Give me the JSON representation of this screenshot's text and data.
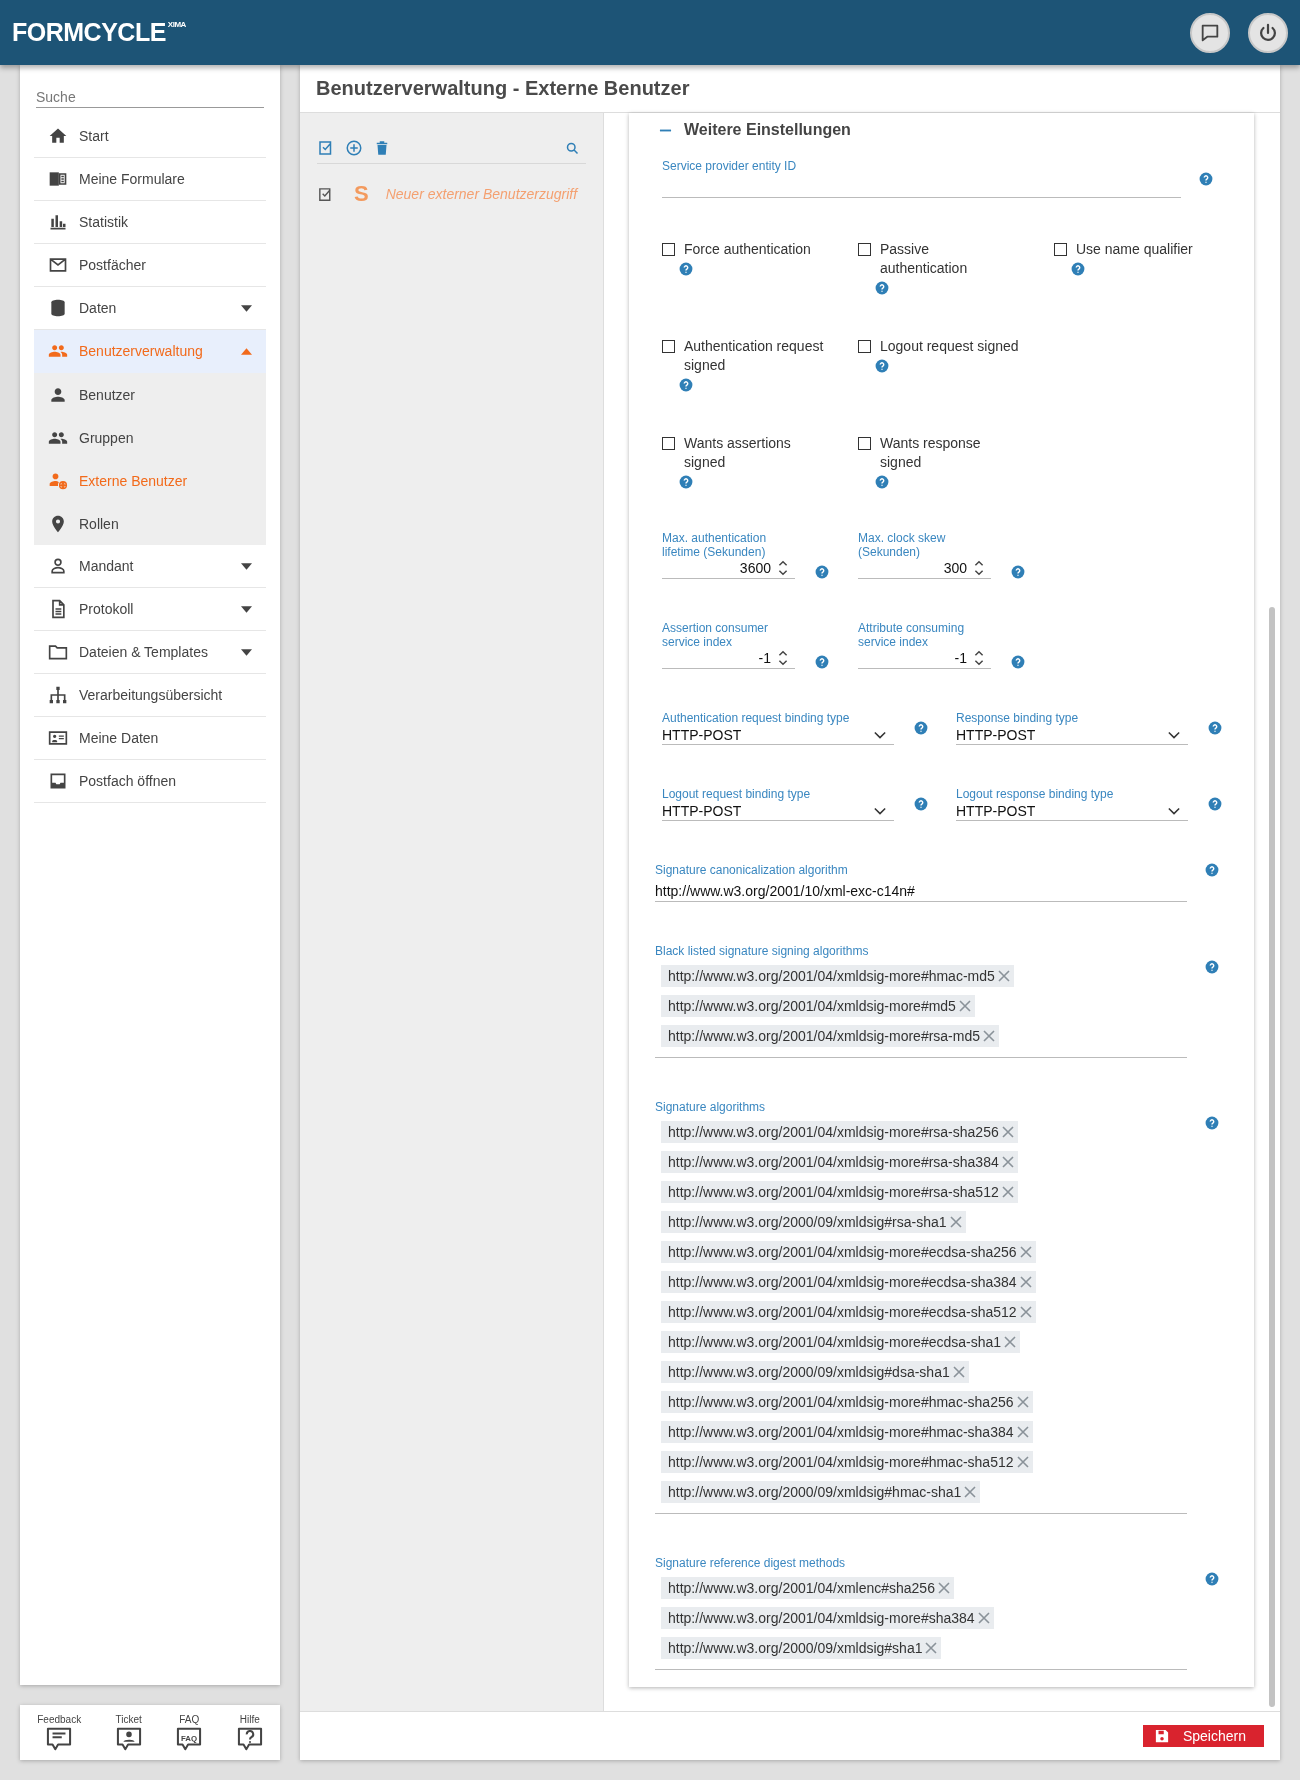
{
  "header": {
    "logo": "FORMCYCLE",
    "logo_sup": "XIMA"
  },
  "sidebar": {
    "search": {
      "placeholder": "Suche"
    },
    "items": [
      {
        "label": "Start",
        "selected": false
      },
      {
        "label": "Meine Formulare",
        "selected": false
      },
      {
        "label": "Statistik",
        "selected": false
      },
      {
        "label": "Postfächer",
        "selected": false
      },
      {
        "label": "Daten",
        "selected": false,
        "expanded": false
      },
      {
        "label": "Benutzerverwaltung",
        "selected": true,
        "expanded": true,
        "children": [
          {
            "label": "Benutzer",
            "selected": false
          },
          {
            "label": "Gruppen",
            "selected": false
          },
          {
            "label": "Externe Benutzer",
            "selected": true
          },
          {
            "label": "Rollen",
            "selected": false
          }
        ]
      },
      {
        "label": "Mandant",
        "selected": false,
        "expanded": false
      },
      {
        "label": "Protokoll",
        "selected": false,
        "expanded": false
      },
      {
        "label": "Dateien & Templates",
        "selected": false,
        "expanded": false
      },
      {
        "label": "Verarbeitungsübersicht",
        "selected": false
      },
      {
        "label": "Meine Daten",
        "selected": false
      },
      {
        "label": "Postfach öffnen",
        "selected": false
      }
    ]
  },
  "footer_links": [
    {
      "label": "Feedback"
    },
    {
      "label": "Ticket"
    },
    {
      "label": "FAQ",
      "icon_text": "FAQ"
    },
    {
      "label": "Hilfe"
    }
  ],
  "page_title": "Benutzerverwaltung - Externe Benutzer",
  "list": {
    "items": [
      {
        "label": "Neuer externer Benutzerzugriff",
        "checked": true,
        "badge": "S"
      }
    ]
  },
  "section": {
    "title": "Weitere Einstellungen",
    "expanded": true,
    "rows": [
      {
        "kind": "text",
        "fields": [
          {
            "label": "Service provider entity ID"
          }
        ]
      },
      {
        "kind": "checkbox",
        "fields": [
          {
            "label": "Force authentication",
            "checked": false
          },
          {
            "label": "Passive authentication",
            "checked": false
          },
          {
            "label": "Use name qualifier",
            "checked": false
          }
        ]
      },
      {
        "kind": "checkbox",
        "fields": [
          {
            "label": "Authentication request signed",
            "checked": false
          },
          {
            "label": "Logout request signed",
            "checked": false
          }
        ]
      },
      {
        "kind": "checkbox",
        "fields": [
          {
            "label": "Wants assertions signed",
            "checked": false
          },
          {
            "label": "Wants response signed",
            "checked": false
          }
        ]
      },
      {
        "kind": "number",
        "fields": [
          {
            "label": "Max. authentication lifetime (Sekunden)",
            "value": "3600"
          },
          {
            "label": "Max. clock skew (Sekunden)",
            "value": "300"
          }
        ]
      },
      {
        "kind": "number",
        "fields": [
          {
            "label": "Assertion consumer service index",
            "value": "-1"
          },
          {
            "label": "Attribute consuming service index",
            "value": "-1"
          }
        ]
      },
      {
        "kind": "select",
        "fields": [
          {
            "label": "Authentication request binding type",
            "value": "HTTP-POST"
          },
          {
            "label": "Response binding type",
            "value": "HTTP-POST"
          }
        ]
      },
      {
        "kind": "select",
        "fields": [
          {
            "label": "Logout request binding type",
            "value": "HTTP-POST"
          },
          {
            "label": "Logout response binding type",
            "value": "HTTP-POST"
          }
        ]
      },
      {
        "kind": "wide",
        "fields": [
          {
            "label": "Signature canonicalization algorithm",
            "value": "http://www.w3.org/2001/10/xml-exc-c14n#"
          }
        ]
      },
      {
        "kind": "tags",
        "fields": [
          {
            "label": "Black listed signature signing algorithms",
            "tags": [
              "http://www.w3.org/2001/04/xmldsig-more#hmac-md5",
              "http://www.w3.org/2001/04/xmldsig-more#md5",
              "http://www.w3.org/2001/04/xmldsig-more#rsa-md5"
            ]
          }
        ]
      },
      {
        "kind": "tags",
        "fields": [
          {
            "label": "Signature algorithms",
            "tags": [
              "http://www.w3.org/2001/04/xmldsig-more#rsa-sha256",
              "http://www.w3.org/2001/04/xmldsig-more#rsa-sha384",
              "http://www.w3.org/2001/04/xmldsig-more#rsa-sha512",
              "http://www.w3.org/2000/09/xmldsig#rsa-sha1",
              "http://www.w3.org/2001/04/xmldsig-more#ecdsa-sha256",
              "http://www.w3.org/2001/04/xmldsig-more#ecdsa-sha384",
              "http://www.w3.org/2001/04/xmldsig-more#ecdsa-sha512",
              "http://www.w3.org/2001/04/xmldsig-more#ecdsa-sha1",
              "http://www.w3.org/2000/09/xmldsig#dsa-sha1",
              "http://www.w3.org/2001/04/xmldsig-more#hmac-sha256",
              "http://www.w3.org/2001/04/xmldsig-more#hmac-sha384",
              "http://www.w3.org/2001/04/xmldsig-more#hmac-sha512",
              "http://www.w3.org/2000/09/xmldsig#hmac-sha1"
            ]
          }
        ]
      },
      {
        "kind": "tags",
        "fields": [
          {
            "label": "Signature reference digest methods",
            "tags": [
              "http://www.w3.org/2001/04/xmlenc#sha256",
              "http://www.w3.org/2001/04/xmldsig-more#sha384",
              "http://www.w3.org/2000/09/xmldsig#sha1"
            ]
          }
        ]
      }
    ]
  },
  "save_button": "Speichern"
}
